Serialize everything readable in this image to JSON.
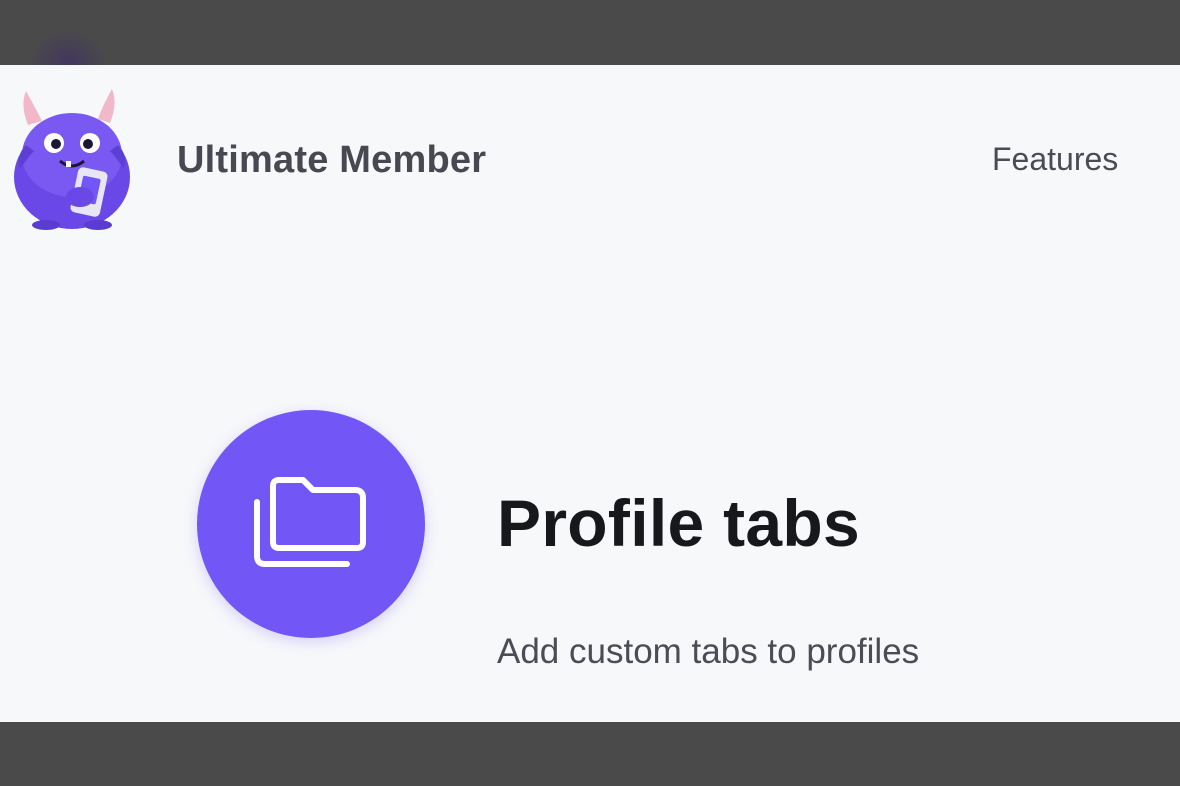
{
  "brand": {
    "name": "Ultimate Member",
    "accent_color": "#7357f6"
  },
  "nav": {
    "features_label": "Features"
  },
  "feature": {
    "icon": "folders-icon",
    "title": "Profile tabs",
    "description": "Add custom tabs to profiles"
  }
}
